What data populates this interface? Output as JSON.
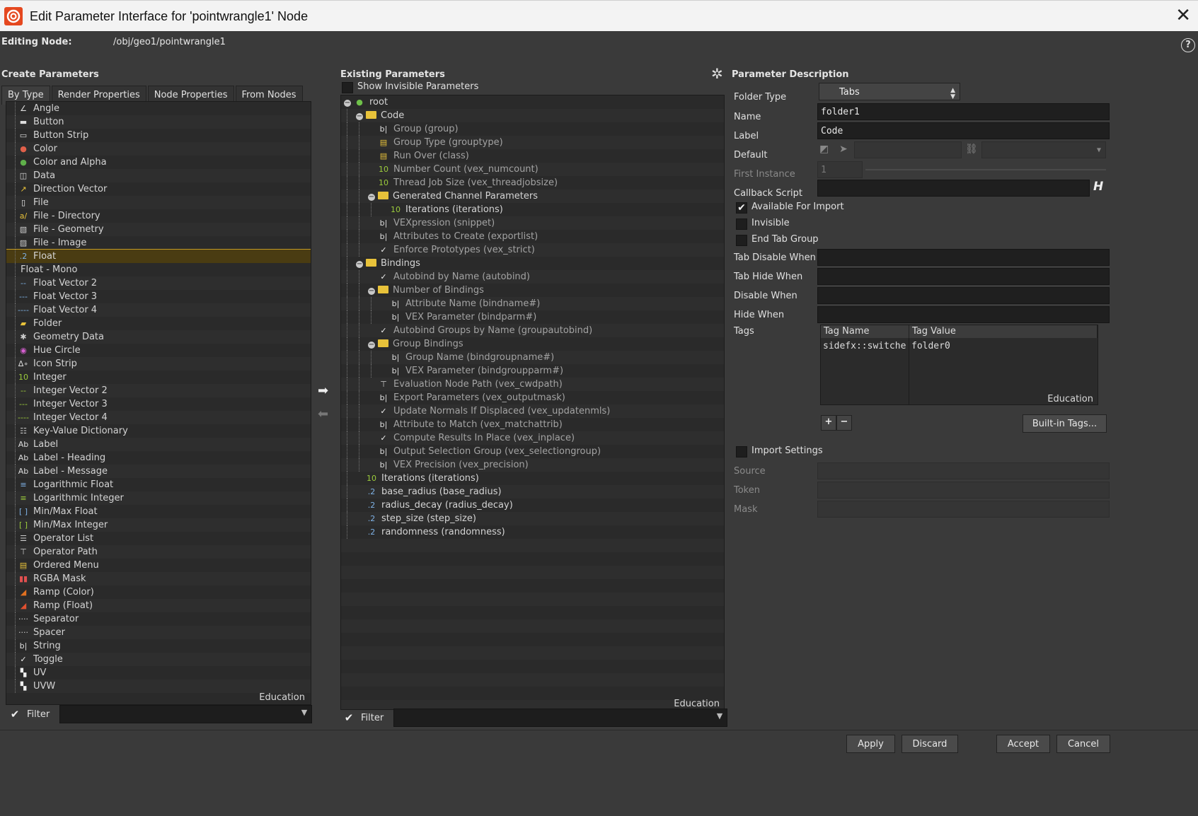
{
  "window": {
    "title": "Edit Parameter Interface for 'pointwrangle1' Node"
  },
  "editing": {
    "label": "Editing Node:",
    "path": "/obj/geo1/pointwrangle1"
  },
  "create": {
    "header": "Create Parameters",
    "tabs": [
      "By Type",
      "Render Properties",
      "Node Properties",
      "From Nodes"
    ],
    "items": [
      {
        "label": "Angle",
        "icon": "angle-icon"
      },
      {
        "label": "Button",
        "icon": "button-icon"
      },
      {
        "label": "Button Strip",
        "icon": "button-strip-icon"
      },
      {
        "label": "Color",
        "icon": "color-icon"
      },
      {
        "label": "Color and Alpha",
        "icon": "color-alpha-icon"
      },
      {
        "label": "Data",
        "icon": "data-icon"
      },
      {
        "label": "Direction Vector",
        "icon": "direction-icon"
      },
      {
        "label": "File",
        "icon": "file-icon"
      },
      {
        "label": "File - Directory",
        "icon": "directory-icon"
      },
      {
        "label": "File - Geometry",
        "icon": "geometry-file-icon"
      },
      {
        "label": "File - Image",
        "icon": "image-file-icon"
      },
      {
        "label": "Float",
        "icon": "float-icon"
      },
      {
        "label": "Float - Mono",
        "icon": ""
      },
      {
        "label": "Float Vector 2",
        "icon": "vector2-icon"
      },
      {
        "label": "Float Vector 3",
        "icon": "vector3-icon"
      },
      {
        "label": "Float Vector 4",
        "icon": "vector4-icon"
      },
      {
        "label": "Folder",
        "icon": "folder-icon"
      },
      {
        "label": "Geometry Data",
        "icon": "geometry-data-icon"
      },
      {
        "label": "Hue Circle",
        "icon": "hue-circle-icon"
      },
      {
        "label": "Icon Strip",
        "icon": "icon-strip-icon"
      },
      {
        "label": "Integer",
        "icon": "integer-icon"
      },
      {
        "label": "Integer Vector 2",
        "icon": "int-vector2-icon"
      },
      {
        "label": "Integer Vector 3",
        "icon": "int-vector3-icon"
      },
      {
        "label": "Integer Vector 4",
        "icon": "int-vector4-icon"
      },
      {
        "label": "Key-Value Dictionary",
        "icon": "dictionary-icon"
      },
      {
        "label": "Label",
        "icon": "label-icon"
      },
      {
        "label": "Label - Heading",
        "icon": "label-heading-icon"
      },
      {
        "label": "Label - Message",
        "icon": "label-message-icon"
      },
      {
        "label": "Logarithmic Float",
        "icon": "log-float-icon"
      },
      {
        "label": "Logarithmic Integer",
        "icon": "log-int-icon"
      },
      {
        "label": "Min/Max Float",
        "icon": "minmax-float-icon"
      },
      {
        "label": "Min/Max Integer",
        "icon": "minmax-int-icon"
      },
      {
        "label": "Operator List",
        "icon": "op-list-icon"
      },
      {
        "label": "Operator Path",
        "icon": "op-path-icon"
      },
      {
        "label": "Ordered Menu",
        "icon": "ordered-menu-icon"
      },
      {
        "label": "RGBA Mask",
        "icon": "rgba-mask-icon"
      },
      {
        "label": "Ramp (Color)",
        "icon": "ramp-color-icon"
      },
      {
        "label": "Ramp (Float)",
        "icon": "ramp-float-icon"
      },
      {
        "label": "Separator",
        "icon": "separator-icon"
      },
      {
        "label": "Spacer",
        "icon": "spacer-icon"
      },
      {
        "label": "String",
        "icon": "string-icon"
      },
      {
        "label": "Toggle",
        "icon": "toggle-icon"
      },
      {
        "label": "UV",
        "icon": "uv-icon"
      },
      {
        "label": "UVW",
        "icon": "uvw-icon"
      }
    ],
    "selected": "Float",
    "watermark": "Education",
    "filter_label": "Filter"
  },
  "existing": {
    "header": "Existing Parameters",
    "show_invisible": "Show Invisible Parameters",
    "tree": [
      {
        "depth": 0,
        "label": "root",
        "icon": "globe",
        "expand": true,
        "dim": false
      },
      {
        "depth": 1,
        "label": "Code",
        "icon": "folder",
        "expand": true,
        "dim": false
      },
      {
        "depth": 2,
        "label": "Group (group)",
        "icon": "string",
        "dim": true
      },
      {
        "depth": 2,
        "label": "Group Type (grouptype)",
        "icon": "menu",
        "dim": true
      },
      {
        "depth": 2,
        "label": "Run Over (class)",
        "icon": "menu",
        "dim": true
      },
      {
        "depth": 2,
        "label": "Number Count (vex_numcount)",
        "icon": "int",
        "dim": true
      },
      {
        "depth": 2,
        "label": "Thread Job Size (vex_threadjobsize)",
        "icon": "int",
        "dim": true
      },
      {
        "depth": 2,
        "label": "Generated Channel Parameters",
        "icon": "folder",
        "expand": true,
        "dim": false
      },
      {
        "depth": 3,
        "label": "Iterations (iterations)",
        "icon": "int",
        "dim": false
      },
      {
        "depth": 2,
        "label": "VEXpression (snippet)",
        "icon": "string",
        "dim": true
      },
      {
        "depth": 2,
        "label": "Attributes to Create (exportlist)",
        "icon": "string",
        "dim": true
      },
      {
        "depth": 2,
        "label": "Enforce Prototypes (vex_strict)",
        "icon": "toggle",
        "dim": true
      },
      {
        "depth": 1,
        "label": "Bindings",
        "icon": "folder",
        "expand": true,
        "dim": false
      },
      {
        "depth": 2,
        "label": "Autobind by Name (autobind)",
        "icon": "toggle",
        "dim": true
      },
      {
        "depth": 2,
        "label": "Number of Bindings",
        "icon": "folder",
        "expand": true,
        "dim": true
      },
      {
        "depth": 3,
        "label": "Attribute Name (bindname#)",
        "icon": "string",
        "dim": true
      },
      {
        "depth": 3,
        "label": "VEX Parameter (bindparm#)",
        "icon": "string",
        "dim": true
      },
      {
        "depth": 2,
        "label": "Autobind Groups by Name (groupautobind)",
        "icon": "toggle",
        "dim": true
      },
      {
        "depth": 2,
        "label": "Group Bindings",
        "icon": "folder",
        "expand": true,
        "dim": true
      },
      {
        "depth": 3,
        "label": "Group Name (bindgroupname#)",
        "icon": "string",
        "dim": true
      },
      {
        "depth": 3,
        "label": "VEX Parameter (bindgroupparm#)",
        "icon": "string",
        "dim": true
      },
      {
        "depth": 2,
        "label": "Evaluation Node Path (vex_cwdpath)",
        "icon": "oppath",
        "dim": true
      },
      {
        "depth": 2,
        "label": "Export Parameters (vex_outputmask)",
        "icon": "string",
        "dim": true
      },
      {
        "depth": 2,
        "label": "Update Normals If Displaced (vex_updatenmls)",
        "icon": "toggle",
        "dim": true
      },
      {
        "depth": 2,
        "label": "Attribute to Match (vex_matchattrib)",
        "icon": "string",
        "dim": true
      },
      {
        "depth": 2,
        "label": "Compute Results In Place (vex_inplace)",
        "icon": "toggle",
        "dim": true
      },
      {
        "depth": 2,
        "label": "Output Selection Group (vex_selectiongroup)",
        "icon": "string",
        "dim": true
      },
      {
        "depth": 2,
        "label": "VEX Precision (vex_precision)",
        "icon": "string",
        "dim": true
      },
      {
        "depth": 1,
        "label": "Iterations (iterations)",
        "icon": "int",
        "dim": false
      },
      {
        "depth": 1,
        "label": "base_radius (base_radius)",
        "icon": "float",
        "dim": false
      },
      {
        "depth": 1,
        "label": "radius_decay (radius_decay)",
        "icon": "float",
        "dim": false
      },
      {
        "depth": 1,
        "label": "step_size (step_size)",
        "icon": "float",
        "dim": false
      },
      {
        "depth": 1,
        "label": "randomness (randomness)",
        "icon": "float",
        "dim": false
      }
    ],
    "watermark": "Education",
    "filter_label": "Filter"
  },
  "desc": {
    "header": "Parameter Description",
    "folder_type_label": "Folder Type",
    "folder_type_value": "Tabs",
    "name_label": "Name",
    "name_value": "folder1",
    "label_label": "Label",
    "label_value": "Code",
    "default_label": "Default",
    "first_instance_label": "First Instance",
    "first_instance_value": "1",
    "callback_label": "Callback Script",
    "callback_lang": "H",
    "available_import": "Available For Import",
    "invisible": "Invisible",
    "end_tab_group": "End Tab Group",
    "tab_disable_when": "Tab Disable When",
    "tab_hide_when": "Tab Hide When",
    "disable_when": "Disable When",
    "hide_when": "Hide When",
    "tags_label": "Tags",
    "tag_headers": [
      "Tag Name",
      "Tag Value"
    ],
    "tag_rows": [
      [
        "sidefx::switche",
        "folder0"
      ]
    ],
    "tags_watermark": "Education",
    "add": "+",
    "remove": "−",
    "builtin_tags": "Built-in Tags...",
    "import_settings": "Import Settings",
    "source": "Source",
    "token": "Token",
    "mask": "Mask"
  },
  "footer": {
    "apply": "Apply",
    "discard": "Discard",
    "accept": "Accept",
    "cancel": "Cancel"
  },
  "colors": {
    "accent_select": "#c39a25",
    "folder": "#e8c23a",
    "int_icon": "#9ccc3c",
    "float_icon": "#7fb2e5"
  }
}
